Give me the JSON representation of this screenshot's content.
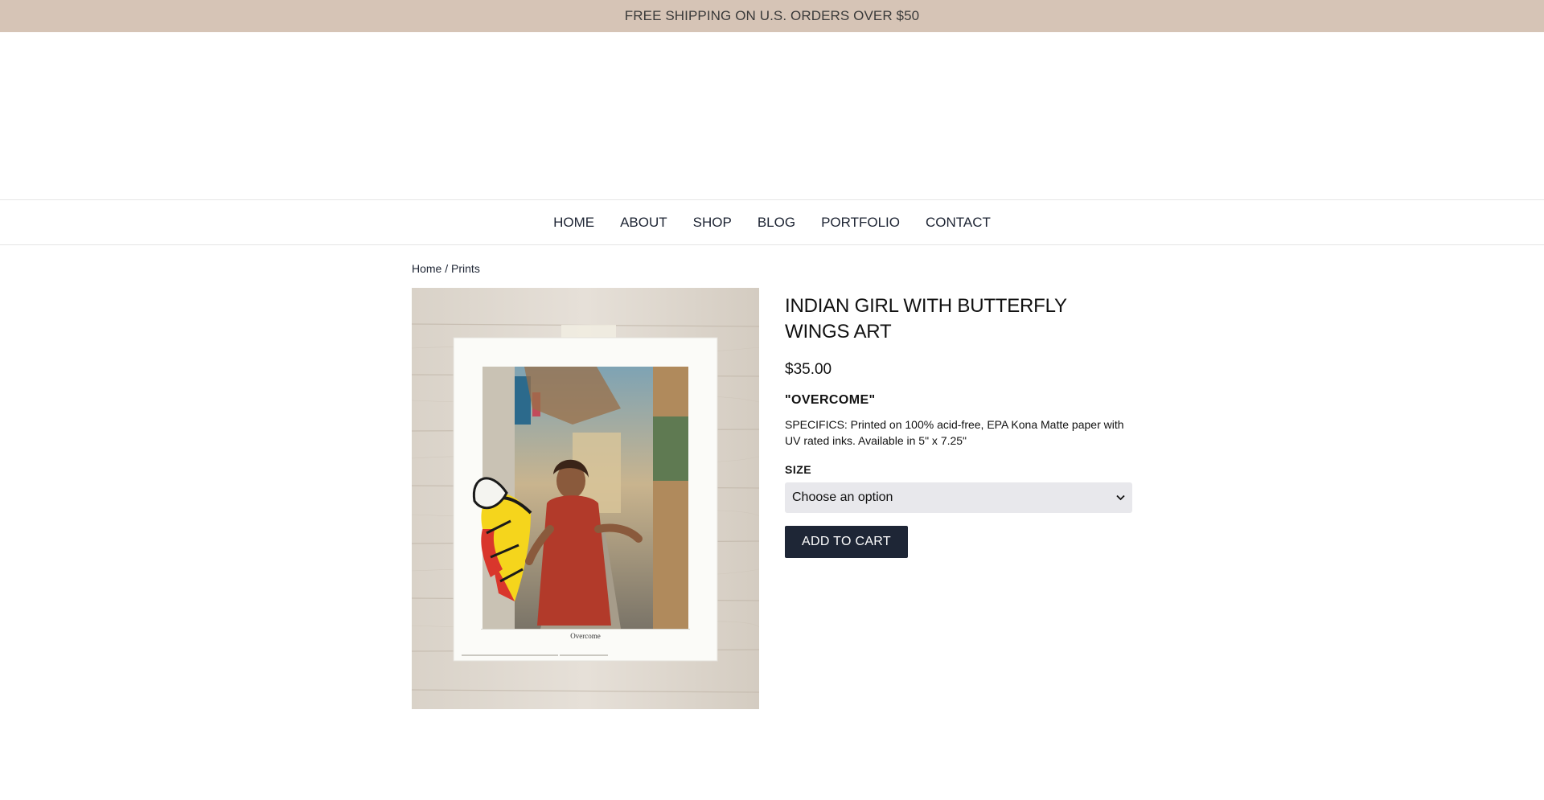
{
  "promo": {
    "text": "FREE SHIPPING ON U.S. ORDERS OVER $50"
  },
  "nav": {
    "items": [
      {
        "label": "HOME"
      },
      {
        "label": "ABOUT"
      },
      {
        "label": "SHOP"
      },
      {
        "label": "BLOG"
      },
      {
        "label": "PORTFOLIO"
      },
      {
        "label": "CONTACT"
      }
    ]
  },
  "breadcrumb": {
    "home": "Home",
    "separator": " / ",
    "category": "Prints"
  },
  "product": {
    "title": "INDIAN GIRL WITH BUTTERFLY WINGS ART",
    "price": "$35.00",
    "subtitle": "\"OVERCOME\"",
    "specifics": "SPECIFICS: Printed on 100% acid-free, EPA Kona Matte paper with UV rated inks. Available in 5\" x 7.25\"",
    "size_label": "SIZE",
    "size_select_value": "Choose an option",
    "add_to_cart": "ADD TO CART",
    "print_caption": "Overcome"
  },
  "colors": {
    "promo_bg": "#d6c4b6",
    "button_bg": "#1e2636",
    "select_bg": "#e8e8ec",
    "text": "#1d2433"
  },
  "icons": {
    "select_arrow": "chevron-down-icon"
  }
}
